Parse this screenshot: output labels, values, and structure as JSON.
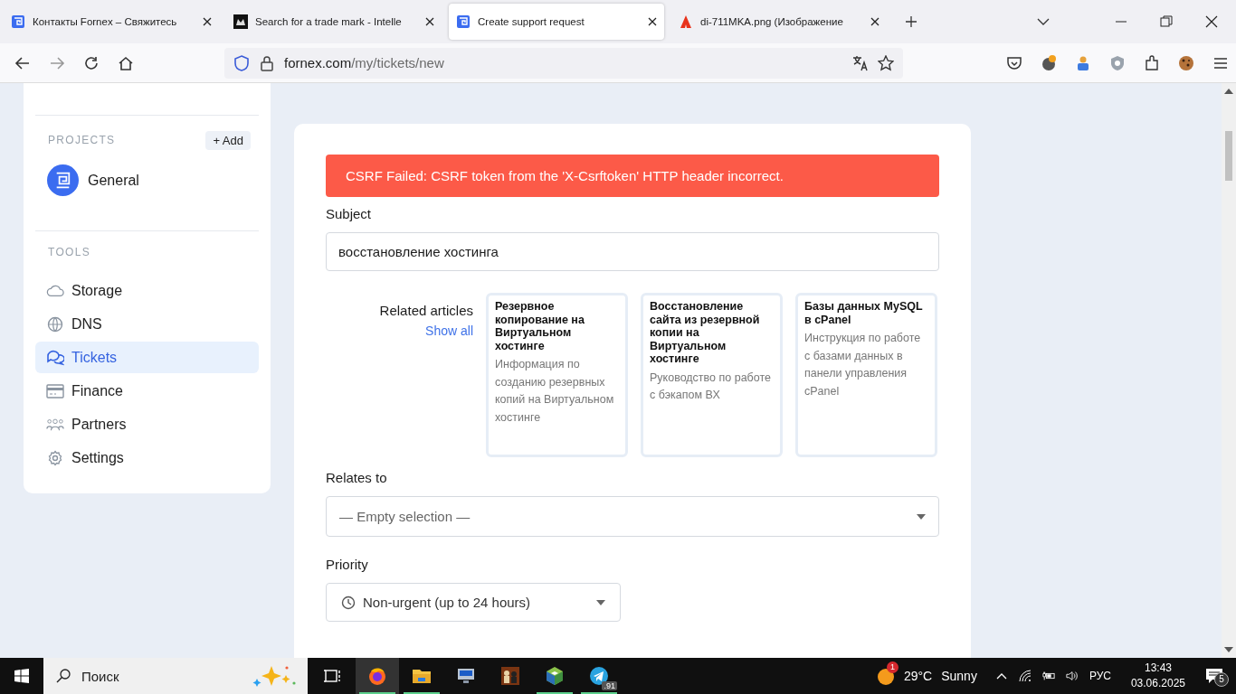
{
  "browser": {
    "tabs": [
      {
        "title": "Контакты Fornex – Свяжитесь",
        "selected": false,
        "kind": "fornex"
      },
      {
        "title": "Search for a trade mark - Intelle",
        "selected": false,
        "kind": "dark"
      },
      {
        "title": "Create support request",
        "selected": true,
        "kind": "fornex"
      },
      {
        "title": "di-711MKA.png (Изображение",
        "selected": false,
        "kind": "pdf"
      }
    ],
    "url_host": "fornex.com",
    "url_path": "/my/tickets/new"
  },
  "sidebar": {
    "sections": [
      {
        "title": "PROJECTS",
        "add": "+ Add"
      }
    ],
    "project": "General",
    "tools_title": "TOOLS",
    "tools": [
      {
        "label": "Storage",
        "kind": "cloud",
        "selected": false
      },
      {
        "label": "DNS",
        "kind": "globe",
        "selected": false
      },
      {
        "label": "Tickets",
        "kind": "chat",
        "selected": true
      },
      {
        "label": "Finance",
        "kind": "card",
        "selected": false
      },
      {
        "label": "Partners",
        "kind": "people",
        "selected": false
      },
      {
        "label": "Settings",
        "kind": "gear",
        "selected": false
      }
    ]
  },
  "form": {
    "error": "CSRF Failed: CSRF token from the 'X-Csrftoken' HTTP header incorrect.",
    "subject_label": "Subject",
    "subject_value": "восстановление хостинга",
    "related_label": "Related articles",
    "show_all": "Show all",
    "articles": [
      {
        "title": "Резервное копирование на Виртуальном хостинге",
        "description": "Информация по созданию резервных копий на Виртуальном хостинге"
      },
      {
        "title": "Восстановление сайта из резервной копии на Виртуальном хостинге",
        "description": "Руководство по работе с бэкапом ВХ"
      },
      {
        "title": "Базы данных MySQL в cPanel",
        "description": "Инструкция по работе с базами данных в панели управления cPanel"
      }
    ],
    "relates_label": "Relates to",
    "relates_placeholder": "— Empty selection —",
    "priority_label": "Priority",
    "priority_value": "Non-urgent (up to 24 hours)"
  },
  "taskbar": {
    "search_placeholder": "Поиск",
    "apps": [
      {
        "kind": "taskview",
        "running": false,
        "selected": false
      },
      {
        "kind": "firefox",
        "running": true,
        "selected": true
      },
      {
        "kind": "folder",
        "running": true,
        "selected": false
      },
      {
        "kind": "remote",
        "running": false,
        "selected": false
      },
      {
        "kind": "chess",
        "running": false,
        "selected": false
      },
      {
        "kind": "cube",
        "running": true,
        "selected": false
      },
      {
        "kind": "telegram",
        "running": true,
        "selected": false,
        "badge": ".91"
      }
    ],
    "weather_badge": "1",
    "temperature": "29°C",
    "weather": "Sunny",
    "language": "РУС",
    "time": "13:43",
    "date": "03.06.2025",
    "notifications": "5"
  }
}
